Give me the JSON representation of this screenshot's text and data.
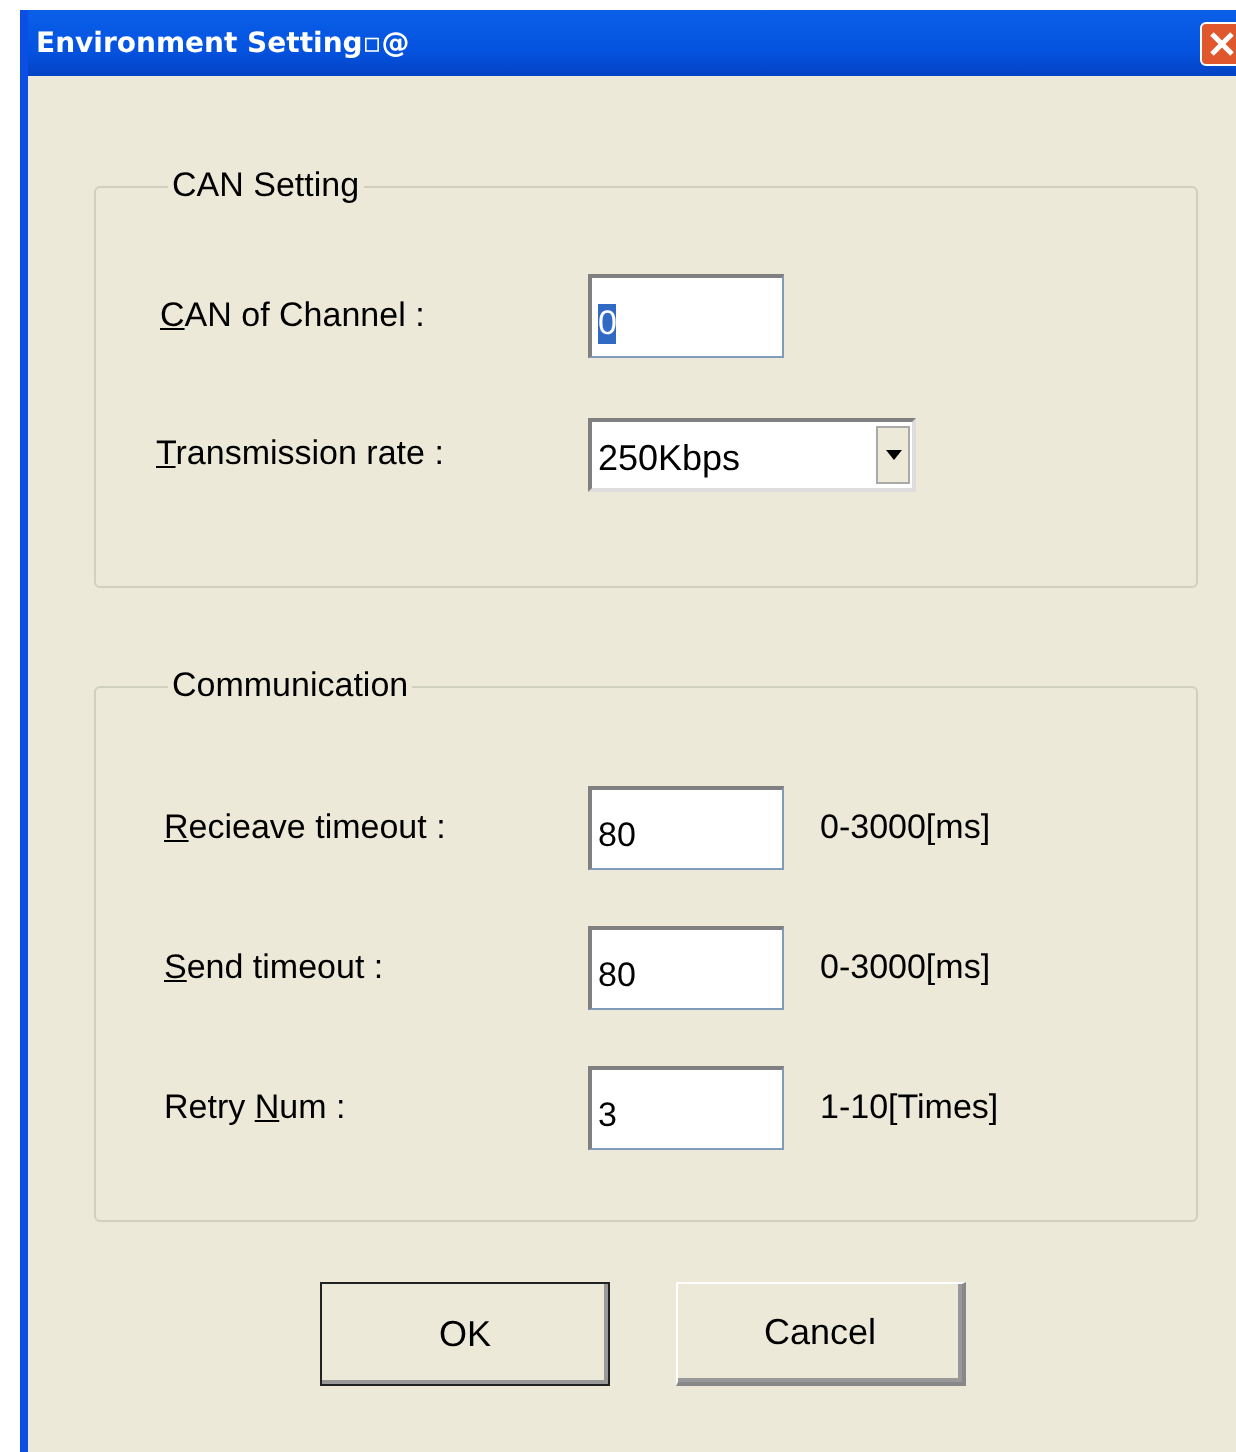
{
  "window": {
    "title": "Environment Setting▫@"
  },
  "groups": [
    {
      "title": "CAN Setting",
      "rows": [
        {
          "kind": "text",
          "label": {
            "key": "C",
            "post": "AN of Channel :"
          },
          "value": "0",
          "value_selected": true
        },
        {
          "kind": "combo",
          "label": {
            "key": "T",
            "post": "ransmission rate :"
          },
          "value": "250Kbps",
          "value_selected": false
        }
      ]
    },
    {
      "title": "Communication",
      "rows": [
        {
          "kind": "text",
          "label": {
            "key": "R",
            "post": "ecieave timeout :"
          },
          "value": "80",
          "value_selected": false,
          "hint": "0-3000[ms]"
        },
        {
          "kind": "text",
          "label": {
            "key": "S",
            "post": "end timeout :"
          },
          "value": "80",
          "value_selected": false,
          "hint": "0-3000[ms]"
        },
        {
          "kind": "text",
          "label": {
            "pre": "Retry ",
            "key": "N",
            "post": "um :"
          },
          "value": "3",
          "value_selected": false,
          "hint": "1-10[Times]"
        }
      ]
    }
  ],
  "buttons": [
    {
      "label": "OK",
      "default": true
    },
    {
      "label": "Cancel",
      "default": false
    }
  ]
}
